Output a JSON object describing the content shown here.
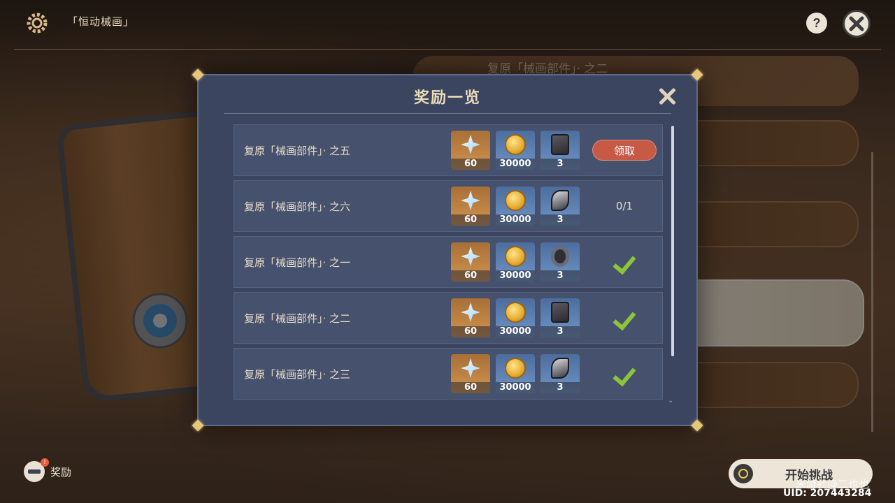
{
  "header": {
    "title": "「恒动械画」",
    "help_label": "?"
  },
  "background": {
    "quest_header_text": "复原「械画部件」· 之二"
  },
  "modal": {
    "title": "奖励一览",
    "rows": [
      {
        "label": "复原「械画部件」· 之五",
        "items": [
          {
            "icon": "primogem-icon",
            "count": "60"
          },
          {
            "icon": "mora-coin-icon",
            "count": "30000"
          },
          {
            "icon": "talent-book-icon",
            "count": "3"
          }
        ],
        "status": {
          "type": "claim",
          "text": "领取"
        }
      },
      {
        "label": "复原「械画部件」· 之六",
        "items": [
          {
            "icon": "primogem-icon",
            "count": "60"
          },
          {
            "icon": "mora-coin-icon",
            "count": "30000"
          },
          {
            "icon": "horn-material-icon",
            "count": "3"
          }
        ],
        "status": {
          "type": "progress",
          "text": "0/1"
        }
      },
      {
        "label": "复原「械画部件」· 之一",
        "items": [
          {
            "icon": "primogem-icon",
            "count": "60"
          },
          {
            "icon": "mora-coin-icon",
            "count": "30000"
          },
          {
            "icon": "ring-material-icon",
            "count": "3"
          }
        ],
        "status": {
          "type": "done",
          "text": ""
        }
      },
      {
        "label": "复原「械画部件」· 之二",
        "items": [
          {
            "icon": "primogem-icon",
            "count": "60"
          },
          {
            "icon": "mora-coin-icon",
            "count": "30000"
          },
          {
            "icon": "talent-book-icon",
            "count": "3"
          }
        ],
        "status": {
          "type": "done",
          "text": ""
        }
      },
      {
        "label": "复原「械画部件」· 之三",
        "items": [
          {
            "icon": "primogem-icon",
            "count": "60"
          },
          {
            "icon": "mora-coin-icon",
            "count": "30000"
          },
          {
            "icon": "horn-material-icon",
            "count": "3"
          }
        ],
        "status": {
          "type": "done",
          "text": ""
        }
      }
    ]
  },
  "footer": {
    "rewards_label": "奖励",
    "rewards_badge": "!",
    "start_label": "开始挑战",
    "watermark": "米游社@二也也",
    "uid": "UID: 207443284"
  },
  "colors": {
    "modal_bg": "#3b4560",
    "claim_button": "#c65a46",
    "check": "#8bc53a",
    "accent_gold": "#e8c77a"
  }
}
